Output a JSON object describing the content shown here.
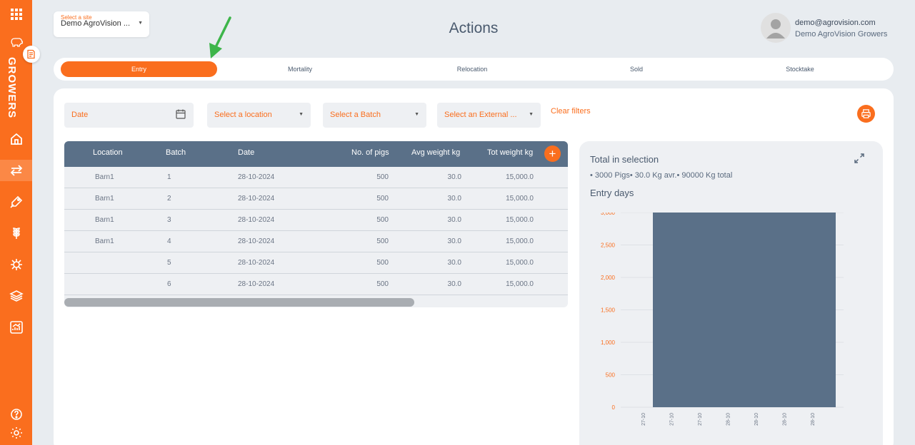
{
  "sidebar": {
    "brand_label": "GROWERS",
    "icons": [
      {
        "name": "apps-grid-icon",
        "interactable": true
      },
      {
        "name": "pig-icon",
        "interactable": true
      },
      {
        "name": "home-icon",
        "interactable": true
      },
      {
        "name": "transfer-arrows-icon",
        "interactable": true
      },
      {
        "name": "feeder-icon",
        "interactable": true
      },
      {
        "name": "grain-icon",
        "interactable": true
      },
      {
        "name": "virus-icon",
        "interactable": true
      },
      {
        "name": "layers-icon",
        "interactable": true
      },
      {
        "name": "analytics-icon",
        "interactable": true
      },
      {
        "name": "help-icon",
        "interactable": true
      },
      {
        "name": "settings-gear-icon",
        "interactable": true
      }
    ]
  },
  "site_select": {
    "label": "Select a site",
    "value": "Demo AgroVision ..."
  },
  "page_title": "Actions",
  "user": {
    "email": "demo@agrovision.com",
    "organization": "Demo AgroVision Growers"
  },
  "tabs": [
    {
      "label": "Entry",
      "active": true
    },
    {
      "label": "Mortality",
      "active": false
    },
    {
      "label": "Relocation",
      "active": false
    },
    {
      "label": "Sold",
      "active": false
    },
    {
      "label": "Stocktake",
      "active": false
    }
  ],
  "filters": {
    "date_placeholder": "Date",
    "location_placeholder": "Select a location",
    "batch_placeholder": "Select a Batch",
    "external_placeholder": "Select an External ...",
    "clear_label": "Clear filters"
  },
  "table": {
    "columns": [
      "Location",
      "Batch",
      "Date",
      "No. of pigs",
      "Avg weight kg",
      "Tot weight kg"
    ],
    "rows": [
      {
        "location": "Barn1",
        "batch": "1",
        "date": "28-10-2024",
        "pigs": "500",
        "avg": "30.0",
        "tot": "15,000.0"
      },
      {
        "location": "Barn1",
        "batch": "2",
        "date": "28-10-2024",
        "pigs": "500",
        "avg": "30.0",
        "tot": "15,000.0"
      },
      {
        "location": "Barn1",
        "batch": "3",
        "date": "28-10-2024",
        "pigs": "500",
        "avg": "30.0",
        "tot": "15,000.0"
      },
      {
        "location": "Barn1",
        "batch": "4",
        "date": "28-10-2024",
        "pigs": "500",
        "avg": "30.0",
        "tot": "15,000.0"
      },
      {
        "location": "",
        "batch": "5",
        "date": "28-10-2024",
        "pigs": "500",
        "avg": "30.0",
        "tot": "15,000.0"
      },
      {
        "location": "",
        "batch": "6",
        "date": "28-10-2024",
        "pigs": "500",
        "avg": "30.0",
        "tot": "15,000.0"
      }
    ]
  },
  "summary": {
    "title": "Total in selection",
    "text": "• 3000 Pigs• 30.0 Kg avr.• 90000 Kg total",
    "subtitle": "Entry days"
  },
  "colors": {
    "accent": "#fa6e1e",
    "header": "#5a7088",
    "bar": "#5a7088",
    "arrow": "#3db54a"
  },
  "chart_data": {
    "type": "bar",
    "title": "Entry days",
    "categories": [
      "27-10",
      "27-10",
      "27-10",
      "28-10",
      "28-10",
      "28-10",
      "28-10"
    ],
    "bar": {
      "from": "27-10",
      "to": "28-10",
      "value": 3000
    },
    "ylim": [
      0,
      3000
    ],
    "yticks": [
      0,
      500,
      1000,
      1500,
      2000,
      2500,
      3000
    ],
    "ytick_labels": [
      "0",
      "500",
      "1,000",
      "1,500",
      "2,000",
      "2,500",
      "3,000"
    ]
  }
}
